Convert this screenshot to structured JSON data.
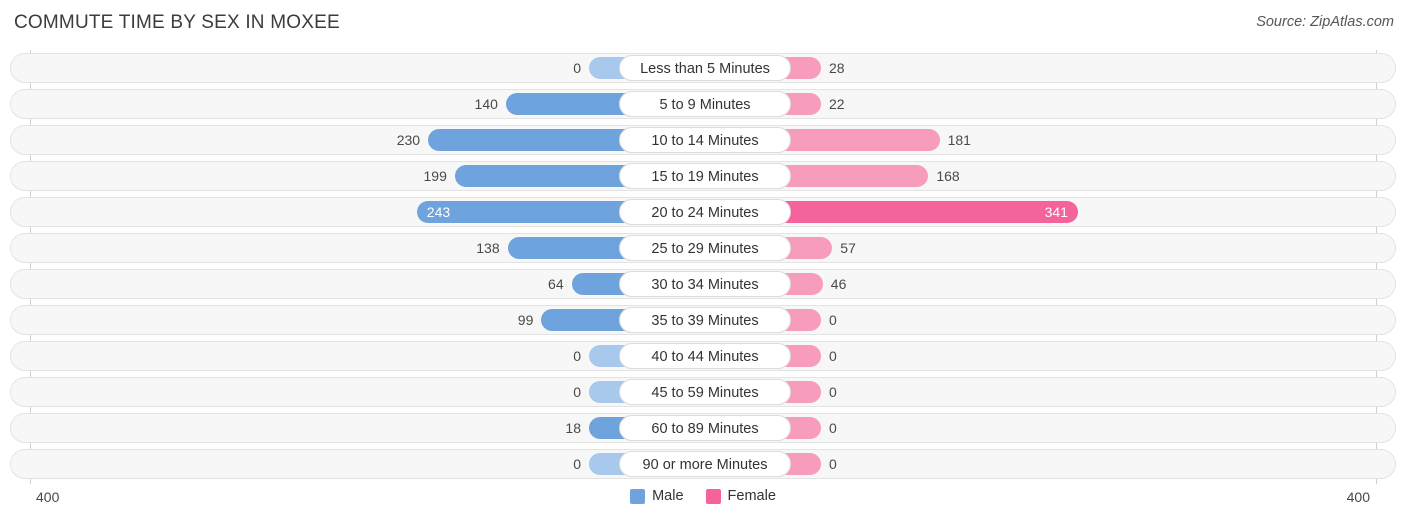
{
  "header": {
    "title": "COMMUTE TIME BY SEX IN MOXEE",
    "source": "Source: ZipAtlas.com"
  },
  "axis": {
    "left_label": "400",
    "right_label": "400"
  },
  "legend": {
    "items": [
      {
        "label": "Male",
        "color": "#6fa3dd"
      },
      {
        "label": "Female",
        "color": "#f4639b"
      }
    ]
  },
  "colors": {
    "male": "#6fa3dd",
    "male_pale": "#a8c8ec",
    "female": "#f79cbc",
    "female_strong": "#f4639b",
    "row_track": "#f7f7f7",
    "row_border": "#e3e3e3",
    "gridline": "#cfcfcf",
    "title": "#3c3c3c"
  },
  "chart_data": {
    "type": "bar",
    "title": "COMMUTE TIME BY SEX IN MOXEE",
    "subtitle": "",
    "orientation": "horizontal-diverging",
    "xlabel": "",
    "ylabel": "",
    "xlim": [
      400,
      400
    ],
    "axis_max": 400,
    "grid": true,
    "legend_position": "bottom-center",
    "categories": [
      "Less than 5 Minutes",
      "5 to 9 Minutes",
      "10 to 14 Minutes",
      "15 to 19 Minutes",
      "20 to 24 Minutes",
      "25 to 29 Minutes",
      "30 to 34 Minutes",
      "35 to 39 Minutes",
      "40 to 44 Minutes",
      "45 to 59 Minutes",
      "60 to 89 Minutes",
      "90 or more Minutes"
    ],
    "series": [
      {
        "name": "Male",
        "color": "#6fa3dd",
        "values": [
          0,
          140,
          230,
          199,
          243,
          138,
          64,
          99,
          0,
          0,
          18,
          0
        ]
      },
      {
        "name": "Female",
        "color": "#f4639b",
        "values": [
          28,
          22,
          181,
          168,
          341,
          57,
          46,
          0,
          0,
          0,
          0,
          0
        ]
      }
    ]
  },
  "rows": [
    {
      "category": "Less than 5 Minutes",
      "male": "0",
      "female": "28"
    },
    {
      "category": "5 to 9 Minutes",
      "male": "140",
      "female": "22"
    },
    {
      "category": "10 to 14 Minutes",
      "male": "230",
      "female": "181"
    },
    {
      "category": "15 to 19 Minutes",
      "male": "199",
      "female": "168"
    },
    {
      "category": "20 to 24 Minutes",
      "male": "243",
      "female": "341"
    },
    {
      "category": "25 to 29 Minutes",
      "male": "138",
      "female": "57"
    },
    {
      "category": "30 to 34 Minutes",
      "male": "64",
      "female": "46"
    },
    {
      "category": "35 to 39 Minutes",
      "male": "99",
      "female": "0"
    },
    {
      "category": "40 to 44 Minutes",
      "male": "0",
      "female": "0"
    },
    {
      "category": "45 to 59 Minutes",
      "male": "0",
      "female": "0"
    },
    {
      "category": "60 to 89 Minutes",
      "male": "18",
      "female": "0"
    },
    {
      "category": "90 or more Minutes",
      "male": "0",
      "female": "0"
    }
  ]
}
